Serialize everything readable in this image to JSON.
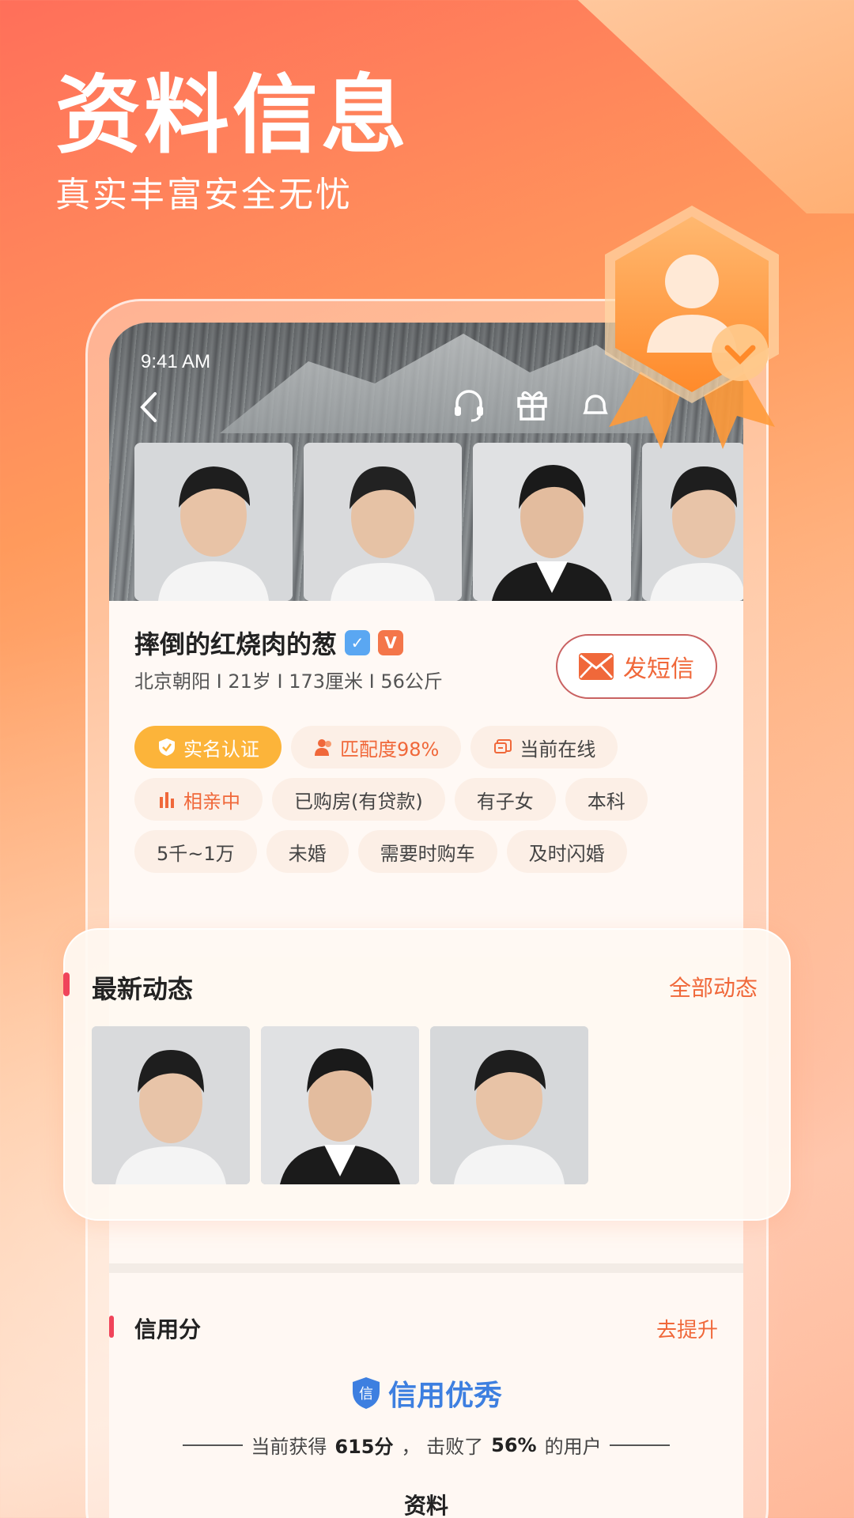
{
  "hero": {
    "title": "资料信息",
    "subtitle": "真实丰富安全无忧"
  },
  "status_bar": {
    "time": "9:41 AM"
  },
  "nav": {
    "icons": [
      "back-icon",
      "headset-icon",
      "gift-icon",
      "bell-icon"
    ]
  },
  "profile": {
    "name": "摔倒的红烧肉的葱",
    "meta": "北京朝阳 I 21岁 I 173厘米 I 56公斤",
    "message_button": "发短信",
    "tags": [
      {
        "label": "实名认证",
        "style": "primary",
        "icon": "shield-check-icon"
      },
      {
        "label": "匹配度98%",
        "style": "orange",
        "icon": "users-icon"
      },
      {
        "label": "当前在线",
        "style": "normal",
        "icon": "chat-icon"
      },
      {
        "label": "相亲中",
        "style": "orange",
        "icon": "bars-icon"
      },
      {
        "label": "已购房(有贷款)",
        "style": "normal"
      },
      {
        "label": "有子女",
        "style": "normal"
      },
      {
        "label": "本科",
        "style": "normal"
      },
      {
        "label": "5千~1万",
        "style": "normal"
      },
      {
        "label": "未婚",
        "style": "normal"
      },
      {
        "label": "需要时购车",
        "style": "normal"
      },
      {
        "label": "及时闪婚",
        "style": "normal"
      }
    ]
  },
  "dynamics": {
    "title": "最新动态",
    "all_link": "全部动态"
  },
  "credit": {
    "title": "信用分",
    "improve_link": "去提升",
    "shield_char": "信",
    "status": "信用优秀",
    "line_prefix": "当前获得",
    "score": "615分",
    "line_mid": "，  击败了",
    "percent": "56%",
    "line_suffix": "的用户"
  },
  "section_next": "资料",
  "colors": {
    "accent": "#f0683a",
    "primary_tag": "#fcb43a",
    "credit_blue": "#3d7fe0",
    "bar_red": "#f0445a"
  }
}
